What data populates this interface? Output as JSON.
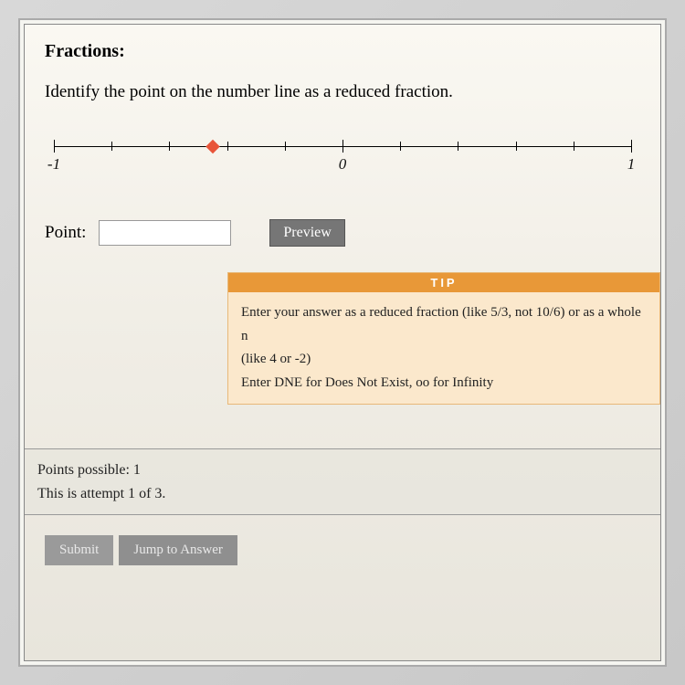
{
  "title": "Fractions:",
  "instruction": "Identify the point on the number line as a reduced fraction.",
  "numberLine": {
    "min": -1,
    "max": 1,
    "labels": {
      "left": "-1",
      "mid": "0",
      "right": "1"
    },
    "pointPercent": 27.5
  },
  "answer": {
    "label": "Point:",
    "value": "",
    "previewLabel": "Preview"
  },
  "tip": {
    "header": "TIP",
    "line1": "Enter your answer as a reduced fraction (like 5/3, not 10/6) or as a whole n",
    "line2": "(like 4 or -2)",
    "line3": "Enter DNE for Does Not Exist, oo for Infinity"
  },
  "footer": {
    "points": "Points possible: 1",
    "attempt": "This is attempt 1 of 3."
  },
  "actions": {
    "submit": "Submit",
    "jump": "Jump to Answer"
  }
}
